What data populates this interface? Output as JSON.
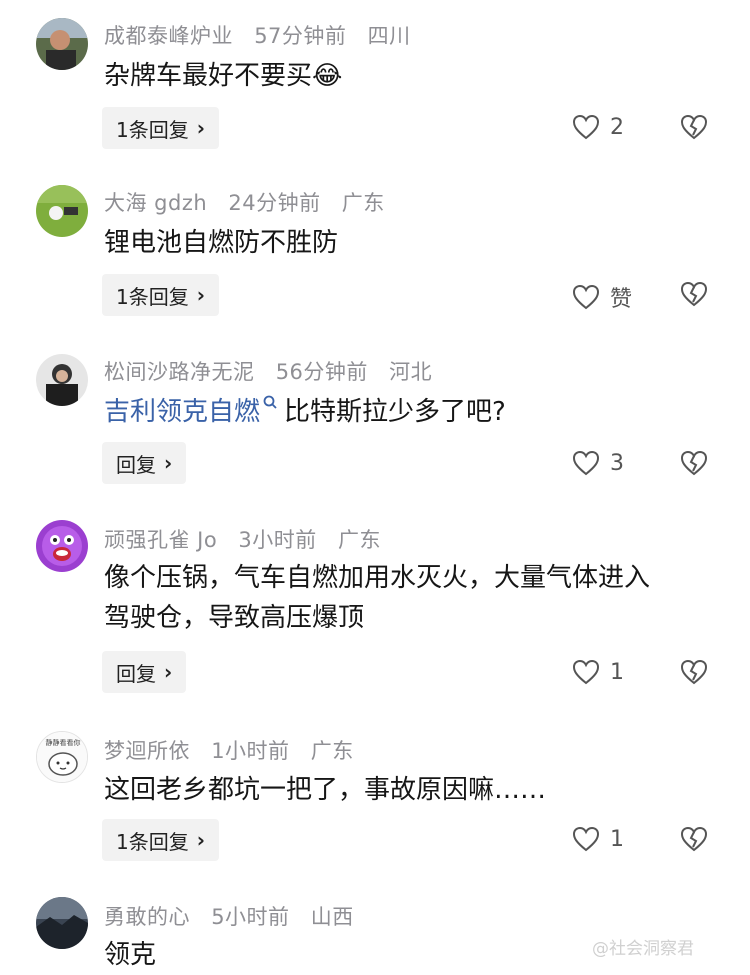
{
  "comments": [
    {
      "username": "成都泰峰炉业",
      "time": "57分钟前",
      "location": "四川",
      "text": "杂牌车最好不要买",
      "emoji": "😂",
      "reply_label": "1条回复",
      "likes": "2",
      "avatar": "avatar-man-portrait"
    },
    {
      "username": "大海 gdzh",
      "time": "24分钟前",
      "location": "广东",
      "text": "锂电池自燃防不胜防",
      "reply_label": "1条回复",
      "likes": "赞",
      "avatar": "avatar-golf-ball"
    },
    {
      "username": "松间沙路净无泥",
      "time": "56分钟前",
      "location": "河北",
      "link_text": "吉利领克自燃",
      "text": "比特斯拉少多了吧?",
      "reply_label": "回复",
      "likes": "3",
      "avatar": "avatar-man-dark"
    },
    {
      "username": "顽强孔雀 Jo",
      "time": "3小时前",
      "location": "广东",
      "text_line1": "像个压锅，气车自燃加用水灭火，大量气体进入",
      "text_line2": "驾驶仓，导致高压爆顶",
      "reply_label": "回复",
      "likes": "1",
      "avatar": "avatar-purple-cartoon"
    },
    {
      "username": "梦迴所依",
      "time": "1小时前",
      "location": "广东",
      "text": "这回老乡都坑一把了，事故原因嘛……",
      "reply_label": "1条回复",
      "likes": "1",
      "avatar": "avatar-white-cat",
      "avatar_text": "静静看看你"
    },
    {
      "username": "勇敢的心",
      "time": "5小时前",
      "location": "山西",
      "text": "领克",
      "avatar": "avatar-dark-landscape"
    }
  ],
  "watermark": "@社会洞察君",
  "icons": {
    "like": "heart-outline-icon",
    "dislike": "broken-heart-icon",
    "search": "search-icon",
    "reply_arrow": "chevron-right-icon"
  },
  "colors": {
    "link": "#3a62a8",
    "meta": "#8f8f94",
    "reply_bg": "#f2f2f2"
  }
}
